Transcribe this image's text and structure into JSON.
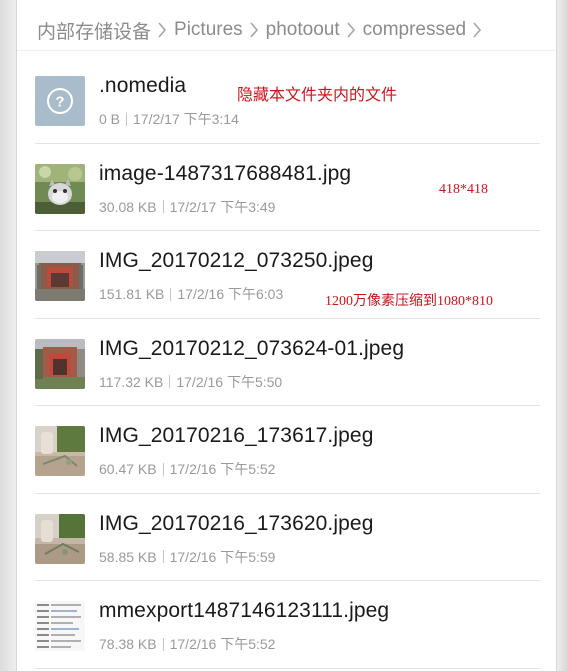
{
  "breadcrumb": {
    "items": [
      "内部存储设备",
      "Pictures",
      "photoout",
      "compressed"
    ]
  },
  "files": [
    {
      "name": ".nomedia",
      "size": "0 B",
      "date": "17/2/17 下午3:14",
      "icon": "unknown-file-icon"
    },
    {
      "name": "image-1487317688481.jpg",
      "size": "30.08 KB",
      "date": "17/2/17 下午3:49",
      "icon": "image-thumbnail"
    },
    {
      "name": "IMG_20170212_073250.jpeg",
      "size": "151.81 KB",
      "date": "17/2/16 下午6:03",
      "icon": "image-thumbnail"
    },
    {
      "name": "IMG_20170212_073624-01.jpeg",
      "size": "117.32 KB",
      "date": "17/2/16 下午5:50",
      "icon": "image-thumbnail"
    },
    {
      "name": "IMG_20170216_173617.jpeg",
      "size": "60.47 KB",
      "date": "17/2/16 下午5:52",
      "icon": "image-thumbnail"
    },
    {
      "name": "IMG_20170216_173620.jpeg",
      "size": "58.85 KB",
      "date": "17/2/16 下午5:59",
      "icon": "image-thumbnail"
    },
    {
      "name": "mmexport1487146123111.jpeg",
      "size": "78.38 KB",
      "date": "17/2/16 下午5:52",
      "icon": "image-thumbnail"
    }
  ],
  "annotations": {
    "hidden_note": "隐藏本文件夹内的文件",
    "dimension_note": "418*418",
    "compress_note": "1200万像素压缩到1080*810"
  },
  "colors": {
    "annotation": "#c8161d",
    "file_name": "#1a1a1a",
    "meta_text": "#9a9a9a",
    "breadcrumb_text": "#8c8c8c",
    "unknown_icon_bg": "#a9bccb"
  }
}
